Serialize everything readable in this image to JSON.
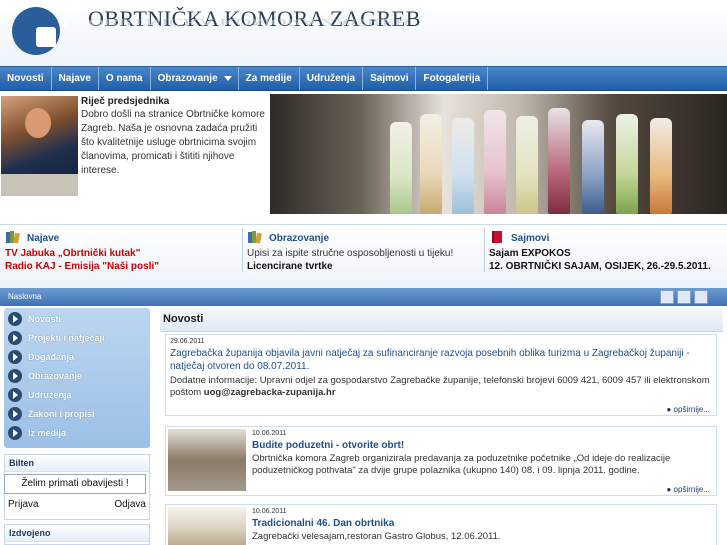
{
  "header": {
    "title": "OBRTNIČKA KOMORA ZAGREB"
  },
  "nav": [
    {
      "label": "Novosti"
    },
    {
      "label": "Najave"
    },
    {
      "label": "O nama"
    },
    {
      "label": "Obrazovanje",
      "dropdown": true
    },
    {
      "label": "Za medije"
    },
    {
      "label": "Udruženja"
    },
    {
      "label": "Sajmovi"
    },
    {
      "label": "Fotogalerija"
    }
  ],
  "president": {
    "heading": "Riječ predsjednika",
    "text": "Dobro došli na stranice Obrtničke komore Zagreb. Naša je osnovna zadaća pružiti što kvalitetnije usluge obrtnicima svojim članovima, promicati i štititi njihove interese."
  },
  "categories": {
    "najave": {
      "title": "Najave",
      "lines": [
        "TV Jabuka „Obrtnički kutak\"",
        "Radio KAJ - Emisija \"Naši posli\""
      ]
    },
    "obrazovanje": {
      "title": "Obrazovanje",
      "lines": [
        "Upisi za ispite stručne osposobljenosti u tijeku!",
        "Licencirane tvrtke"
      ]
    },
    "sajmovi": {
      "title": "Sajmovi",
      "lines": [
        "Sajam EXPOKOS",
        "12. OBRTNIČKI SAJAM, OSIJEK, 26.-29.5.2011."
      ]
    }
  },
  "breadcrumb": "Naslovna",
  "left_menu": [
    "Novosti",
    "Projekti i natječaji",
    "Događanja",
    "Obrazovanje",
    "Udruženja",
    "Zakoni i propisi",
    "Iz medija"
  ],
  "bilten": {
    "title": "Bilten",
    "button": "Želim primati obavijesti !",
    "signup": "Prijava",
    "unsubscribe": "Odjava"
  },
  "izdvojeno": {
    "title": "Izdvojeno"
  },
  "main": {
    "heading": "Novosti",
    "more_label": "opširnije...",
    "news": [
      {
        "date": "29.06.2011",
        "title": "Zagrebačka županija objavila javni natječaj za sufinanciranje razvoja posebnih oblika turizma u Zagrebačkoj županiji - natječaj otvoren do 08.07.2011.",
        "body": "Dodatne informacije: Upravni odjel za gospodarstvo Zagrebačke županije, telefonski brojevi 6009 421, 6009 457 ili elektronskom poštom",
        "email": "uog@zagrebacka-zupanija.hr"
      },
      {
        "date": "10.06.2011",
        "title": "Budite poduzetni - otvorite obrt!",
        "body": "Obrtnička komora Zagreb organizirala predavanja za poduzetnike početnike „Od ideje do realizacije poduzetničkog pothvata\" za dvije grupe polaznika (ukupno 140) 08. i 09. lipnja 2011. godine."
      },
      {
        "date": "10.06.2011",
        "title": "Tradicionalni 46. Dan obrtnika",
        "body": "Zagrebački velesajam,restoran Gastro Globus, 12.06.2011."
      }
    ]
  },
  "colors": {
    "nav": "#2f6fb5",
    "link": "#1f4f8f",
    "alert": "#cc0000"
  }
}
